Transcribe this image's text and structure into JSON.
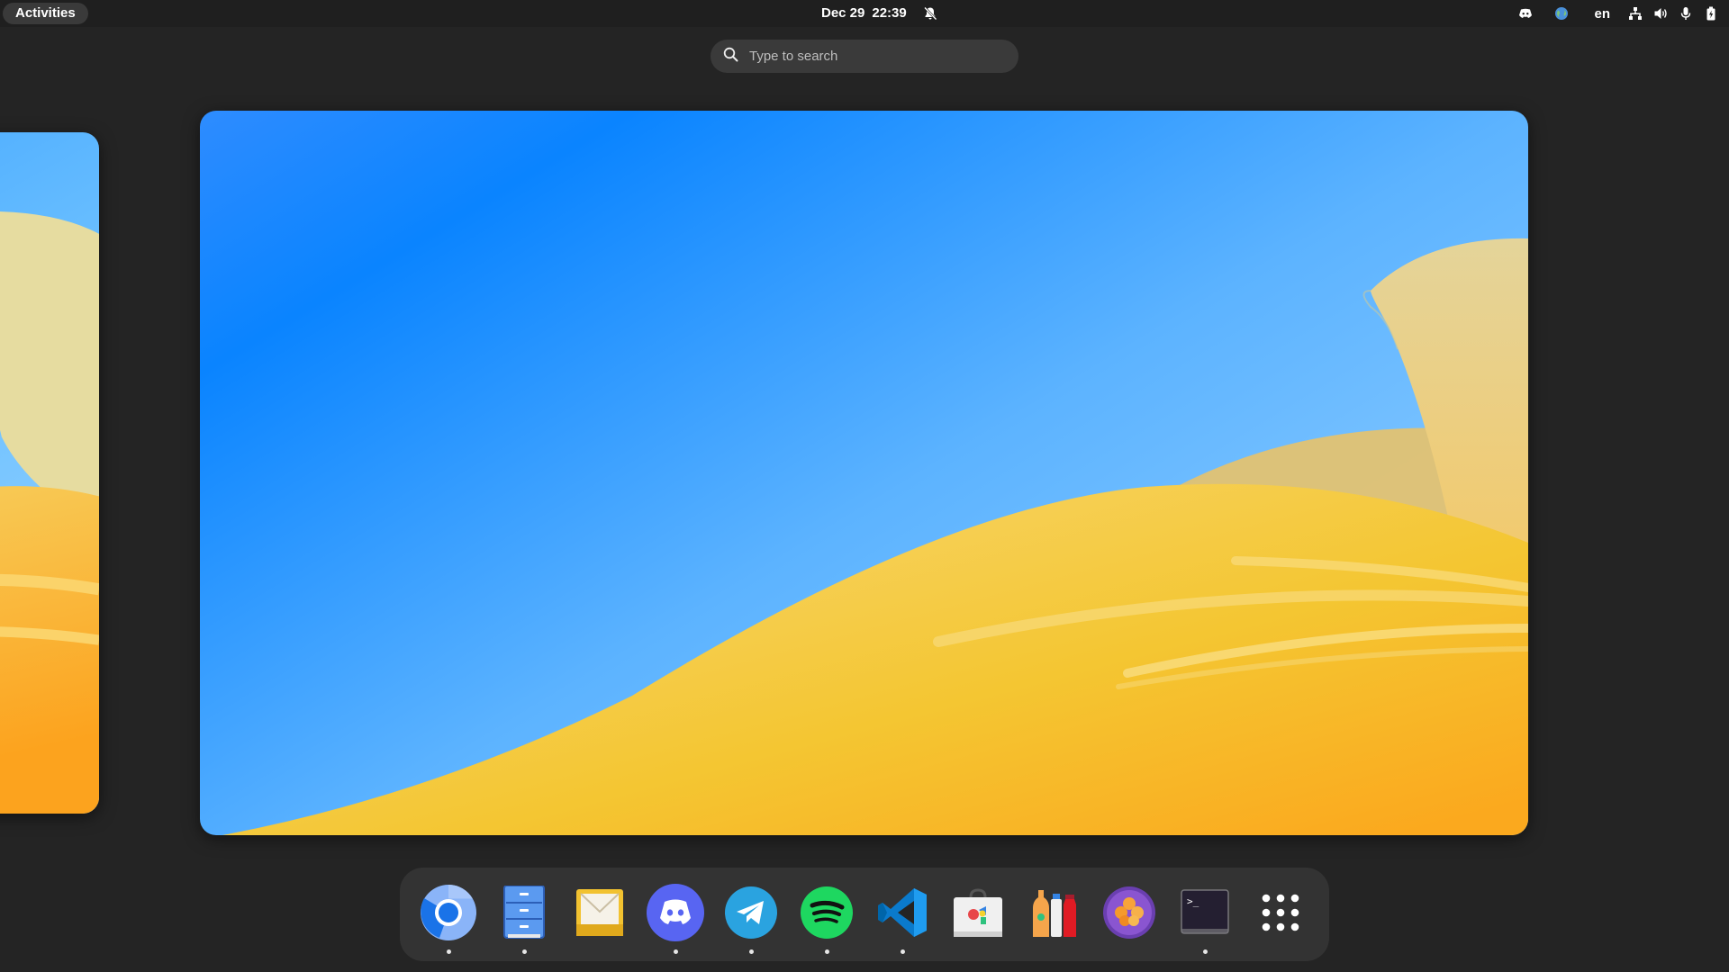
{
  "topbar": {
    "activities_label": "Activities",
    "date": "Dec 29",
    "time": "22:39",
    "language": "en",
    "icons": [
      "discord-tray-icon",
      "globe-icon",
      "network-icon",
      "volume-icon",
      "microphone-icon",
      "battery-icon"
    ]
  },
  "search": {
    "placeholder": "Type to search"
  },
  "dash": {
    "apps": [
      {
        "name": "Chromium",
        "icon": "chromium-icon",
        "running": true
      },
      {
        "name": "Files",
        "icon": "files-icon",
        "running": true
      },
      {
        "name": "Mail",
        "icon": "mail-icon",
        "running": false
      },
      {
        "name": "Discord",
        "icon": "discord-icon",
        "running": true
      },
      {
        "name": "Telegram",
        "icon": "telegram-icon",
        "running": true
      },
      {
        "name": "Spotify",
        "icon": "spotify-icon",
        "running": true
      },
      {
        "name": "Visual Studio Code",
        "icon": "vscode-icon",
        "running": true
      },
      {
        "name": "Software",
        "icon": "software-store-icon",
        "running": false
      },
      {
        "name": "Bottles",
        "icon": "bottles-icon",
        "running": false
      },
      {
        "name": "Flatseal",
        "icon": "flatseal-icon",
        "running": false
      },
      {
        "name": "Terminal",
        "icon": "terminal-icon",
        "running": true
      },
      {
        "name": "Show Apps",
        "icon": "app-grid-icon",
        "running": false
      }
    ]
  },
  "colors": {
    "panel": "#1f1f1f",
    "background": "#242424",
    "dash": "#333333",
    "sky_top": "#0a84ff",
    "sand": "#f6c02c"
  }
}
